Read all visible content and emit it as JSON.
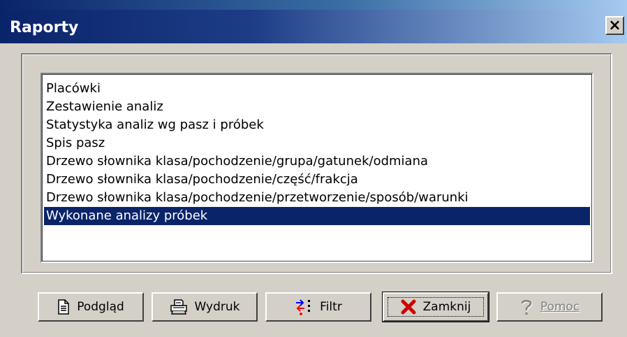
{
  "window": {
    "title": "Raporty",
    "close_label": "×"
  },
  "report_list": {
    "items": [
      "Placówki",
      "Zestawienie analiz",
      "Statystyka analiz wg pasz i próbek",
      "Spis pasz",
      "Drzewo słownika klasa/pochodzenie/grupa/gatunek/odmiana",
      "Drzewo słownika klasa/pochodzenie/część/frakcja",
      "Drzewo słownika klasa/pochodzenie/przetworzenie/sposób/warunki",
      "Wykonane analizy próbek"
    ],
    "selected_index": 7
  },
  "buttons": {
    "preview": {
      "label": "Podgląd",
      "icon": "document-icon"
    },
    "print": {
      "label": "Wydruk",
      "icon": "printer-icon"
    },
    "filter": {
      "label": "Filtr",
      "icon": "filter-icon"
    },
    "close": {
      "label": "Zamknij",
      "icon": "red-x-icon"
    },
    "help": {
      "label": "Pomoc",
      "icon": "question-mark-icon",
      "enabled": false
    }
  },
  "colors": {
    "selection": "#0a246a",
    "titlebar_start": "#0a246a",
    "titlebar_end": "#a6caf0",
    "face": "#d4d0c8"
  }
}
